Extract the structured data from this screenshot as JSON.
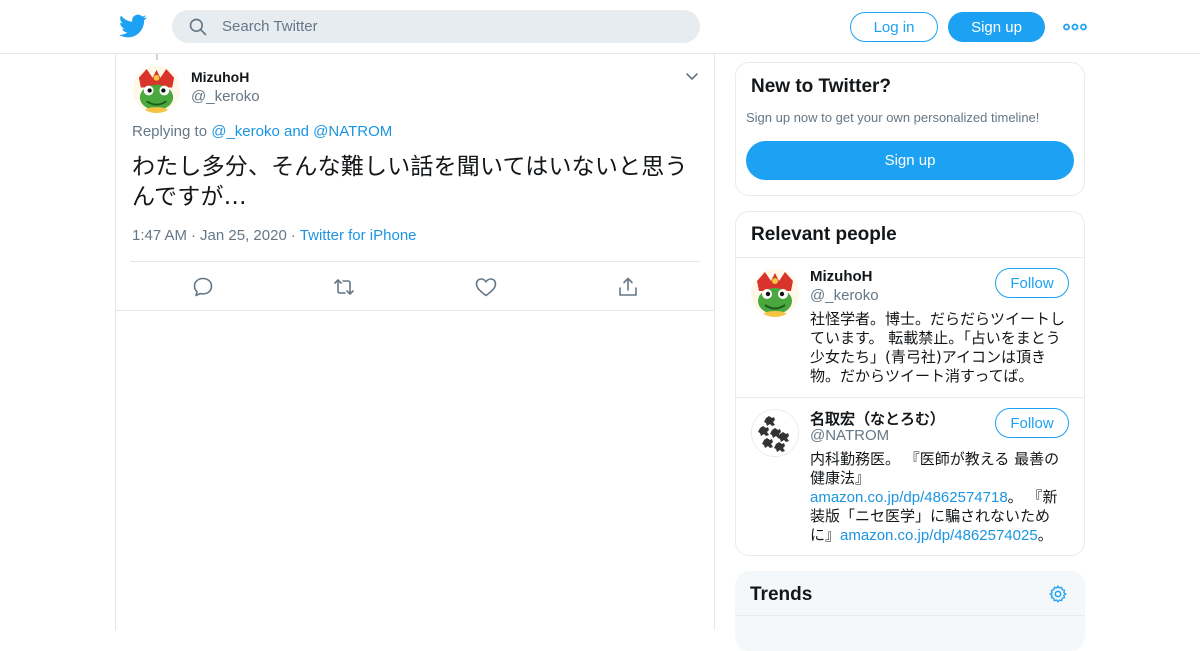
{
  "header": {
    "logo_icon": "twitter-bird-icon",
    "search_placeholder": "Search Twitter",
    "login_label": "Log in",
    "signup_label": "Sign up",
    "more_icon": "more-dots-icon",
    "brand_color": "#1da1f2"
  },
  "tweet": {
    "author_name": "MizuhoH",
    "author_handle": "@_keroko",
    "replying_prefix": "Replying to",
    "reply_to": "@_keroko and @NATROM",
    "text": "わたし多分、そんな難しい話を聞いてはいないと思うんですが…",
    "time": "1:47 AM",
    "date": "Jan 25, 2020",
    "source": "Twitter for iPhone",
    "actions": [
      "reply-icon",
      "retweet-icon",
      "like-icon",
      "share-icon"
    ]
  },
  "new_to_twitter": {
    "title": "New to Twitter?",
    "subtitle": "Sign up now to get your own personalized timeline!",
    "signup_label": "Sign up"
  },
  "relevant_people": {
    "title": "Relevant people",
    "people": [
      {
        "name": "MizuhoH",
        "handle": "@_keroko",
        "follow_label": "Follow",
        "bio": "社怪学者。博士。だらだらツイートしています。 転載禁止。「占いをまとう少女たち」(青弓社)アイコンは頂き物。だからツイート消すってば。"
      },
      {
        "name": "名取宏（なとろむ）",
        "handle": "@NATROM",
        "follow_label": "Follow",
        "bio_part1": "内科勤務医。 『医師が教える 最善の健康法』",
        "bio_link1": "amazon.co.jp/dp/4862574718",
        "bio_part2": "。 『新装版「ニセ医学」に騙されないために』",
        "bio_link2": "amazon.co.jp/dp/4862574025",
        "bio_part3": "。"
      }
    ]
  },
  "trends": {
    "title": "Trends",
    "settings_icon": "gear-icon"
  }
}
